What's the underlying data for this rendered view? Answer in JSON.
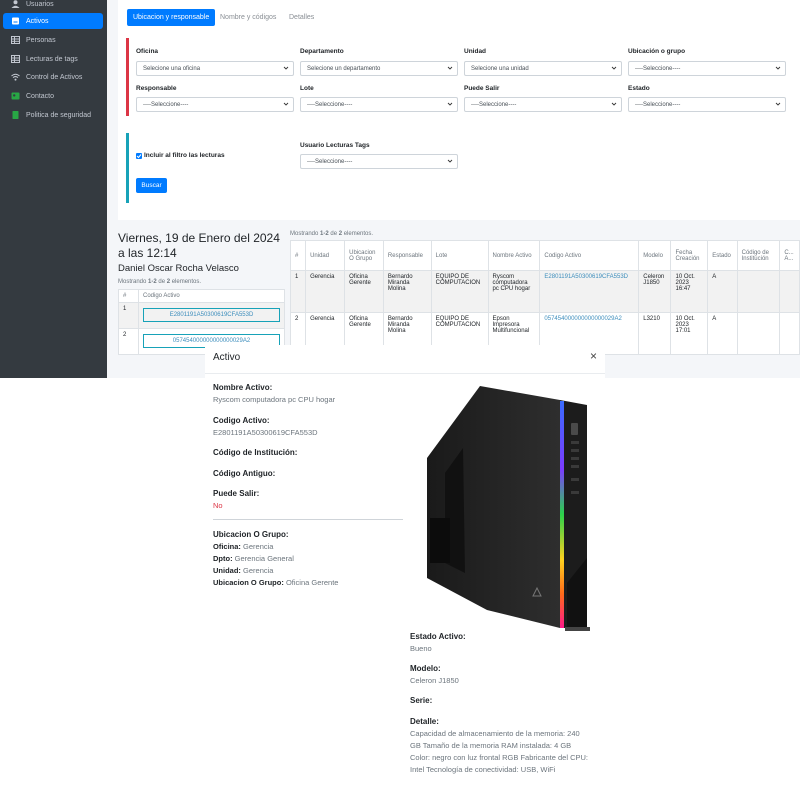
{
  "sidebar": {
    "items": [
      {
        "label": "Usuarios",
        "icon": "user-icon",
        "active": false
      },
      {
        "label": "Activos",
        "icon": "box-icon",
        "active": true
      },
      {
        "label": "Personas",
        "icon": "table-icon",
        "active": false
      },
      {
        "label": "Lecturas de tags",
        "icon": "table-icon",
        "active": false
      },
      {
        "label": "Control de Activos",
        "icon": "wifi-icon",
        "active": false
      },
      {
        "label": "Contacto",
        "icon": "contact-icon",
        "active": false
      },
      {
        "label": "Politica de seguridad",
        "icon": "document-icon",
        "active": false
      }
    ]
  },
  "tabs": [
    {
      "label": "Ubicacion y responsable",
      "active": true
    },
    {
      "label": "Nombre y códigos",
      "active": false
    },
    {
      "label": "Detalles",
      "active": false
    }
  ],
  "filters": {
    "oficina": {
      "label": "Oficina",
      "value": "Selecione una oficina"
    },
    "departamento": {
      "label": "Departamento",
      "value": "Selecione un departamento"
    },
    "unidad": {
      "label": "Unidad",
      "value": "Selecione una unidad"
    },
    "ubicacion_grupo": {
      "label": "Ubicación o grupo",
      "value": "----Seleccione----"
    },
    "responsable": {
      "label": "Responsable",
      "value": "----Seleccione----"
    },
    "lote": {
      "label": "Lote",
      "value": "----Seleccione----"
    },
    "puede_salir": {
      "label": "Puede Salir",
      "value": "----Seleccione----"
    },
    "estado": {
      "label": "Estado",
      "value": "----Seleccione----"
    }
  },
  "lecturas": {
    "checkbox_label": "Incluir al filtro las lecturas",
    "checked": true,
    "usuario_label": "Usuario Lecturas Tags",
    "usuario_value": "----Seleccione----",
    "buscar_label": "Buscar"
  },
  "summary": {
    "date": "Viernes, 19 de Enero del 2024 a las 12:14",
    "user": "Daniel Oscar Rocha Velasco",
    "showing_prefix": "Mostrando ",
    "showing_range": "1-2",
    "showing_mid": " de ",
    "showing_total": "2",
    "showing_suffix": " elementos."
  },
  "left_table": {
    "headers": [
      "#",
      "Codigo Activo"
    ],
    "rows": [
      {
        "n": "1",
        "code": "E2801191A50300619CFA553D"
      },
      {
        "n": "2",
        "code": "057454000000000000029A2"
      }
    ]
  },
  "main_table": {
    "headers": [
      "#",
      "Unidad",
      "Ubicacion O Grupo",
      "Responsable",
      "Lote",
      "Nombre Activo",
      "Codigo Activo",
      "Modelo",
      "Fecha Creación",
      "Estado",
      "Código de Institución",
      "C... A..."
    ],
    "rows": [
      {
        "n": "1",
        "unidad": "Gerencia",
        "ubicacion": "Oficina Gerente",
        "responsable": "Bernardo Miranda Molina",
        "lote": "EQUIPO DE COMPUTACION",
        "nombre": "Ryscom computadora pc CPU hogar",
        "codigo": "E2801191A50300619CFA553D",
        "modelo": "Celeron J1850",
        "fecha": "10 Oct. 2023 16:47",
        "estado": "A"
      },
      {
        "n": "2",
        "unidad": "Gerencia",
        "ubicacion": "Oficina Gerente",
        "responsable": "Bernardo Miranda Molina",
        "lote": "EQUIPO DE COMPUTACION",
        "nombre": "Epson Impresora Multifuncional",
        "codigo": "057454000000000000029A2",
        "modelo": "L3210",
        "fecha": "10 Oct. 2023 17:01",
        "estado": "A"
      }
    ]
  },
  "modal": {
    "title": "Activo",
    "close": "×",
    "nombre_label": "Nombre Activo:",
    "nombre_value": "Ryscom computadora pc CPU hogar",
    "codigo_label": "Codigo Activo:",
    "codigo_value": "E2801191A50300619CFA553D",
    "institucion_label": "Código de Institución:",
    "antiguo_label": "Código Antiguo:",
    "salir_label": "Puede Salir:",
    "salir_value": "No",
    "ubicacion_label": "Ubicacion O Grupo:",
    "oficina_key": "Oficina:",
    "oficina_val": "Gerencia",
    "dpto_key": "Dpto:",
    "dpto_val": "Gerencia General",
    "unidad_key": "Unidad:",
    "unidad_val": "Gerencia",
    "ubic_key": "Ubicacion O Grupo:",
    "ubic_val": "Oficina Gerente",
    "estado_label": "Estado Activo:",
    "estado_value": "Bueno",
    "modelo_label": "Modelo:",
    "modelo_value": "Celeron J1850",
    "serie_label": "Serie:",
    "detalle_label": "Detalle:",
    "detalle_lines": [
      "Capacidad de almacenamiento de la memoria: 240",
      "GB Tamaño de la memoria RAM instalada: 4 GB",
      "Color: negro con luz frontal RGB Fabricante del CPU:",
      "Intel Tecnología de conectividad: USB, WiFi"
    ]
  },
  "colors": {
    "primary": "#007bff",
    "danger": "#dc3545",
    "info": "#17a2b8",
    "sidebar": "#343a40"
  }
}
